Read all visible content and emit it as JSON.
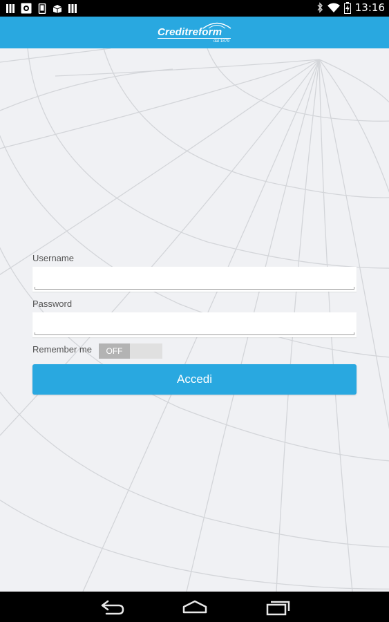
{
  "status_bar": {
    "time": "13:16",
    "left_icons": [
      "bars-icon",
      "photo-icon",
      "phone-icon",
      "box-icon",
      "bars-icon"
    ],
    "right_icons": [
      "bluetooth-icon",
      "wifi-icon",
      "battery-charging-icon"
    ]
  },
  "header": {
    "logo_text": "Creditreform",
    "logo_subtext": "dal 1879",
    "background": "#29a8e0"
  },
  "form": {
    "username_label": "Username",
    "username_value": "",
    "password_label": "Password",
    "password_value": "",
    "remember_label": "Remember me",
    "remember_state": "OFF",
    "submit_label": "Accedi"
  },
  "nav_bar": {
    "buttons": [
      "back-icon",
      "home-icon",
      "recent-apps-icon"
    ]
  },
  "colors": {
    "accent": "#29a8e0",
    "page_bg": "#f0f1f4",
    "globe_lines": "#d3d5d9"
  }
}
